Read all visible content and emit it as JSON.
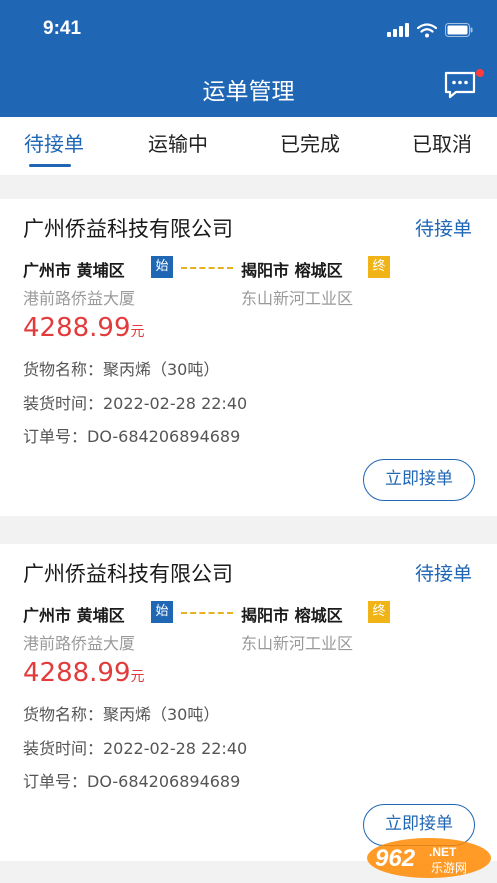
{
  "status_bar": {
    "time": "9:41"
  },
  "header": {
    "title": "运单管理"
  },
  "tabs": [
    {
      "label": "待接单",
      "active": true
    },
    {
      "label": "运输中",
      "active": false
    },
    {
      "label": "已完成",
      "active": false
    },
    {
      "label": "已取消",
      "active": false
    }
  ],
  "orders": [
    {
      "company": "广州侨益科技有限公司",
      "status": "待接单",
      "from": "广州市 黄埔区",
      "from_badge": "始",
      "to": "揭阳市 榕城区",
      "to_badge": "终",
      "from_address": "港前路侨益大厦",
      "to_address": "东山新河工业区",
      "price": "4288.99",
      "price_unit": "元",
      "goods": "货物名称：聚丙烯（30吨）",
      "load_time": "装货时间：2022-02-28 22:40",
      "order_no": "订单号：DO-684206894689",
      "action": "立即接单"
    },
    {
      "company": "广州侨益科技有限公司",
      "status": "待接单",
      "from": "广州市 黄埔区",
      "from_badge": "始",
      "to": "揭阳市 榕城区",
      "to_badge": "终",
      "from_address": "港前路侨益大厦",
      "to_address": "东山新河工业区",
      "price": "4288.99",
      "price_unit": "元",
      "goods": "货物名称：聚丙烯（30吨）",
      "load_time": "装货时间：2022-02-28 22:40",
      "order_no": "订单号：DO-684206894689",
      "action": "立即接单"
    }
  ],
  "watermark": {
    "number": "962",
    "suffix": ".NET",
    "text": "乐游网"
  },
  "colors": {
    "primary": "#1f66b5",
    "price": "#e23b3b",
    "end_badge": "#f0b417"
  }
}
